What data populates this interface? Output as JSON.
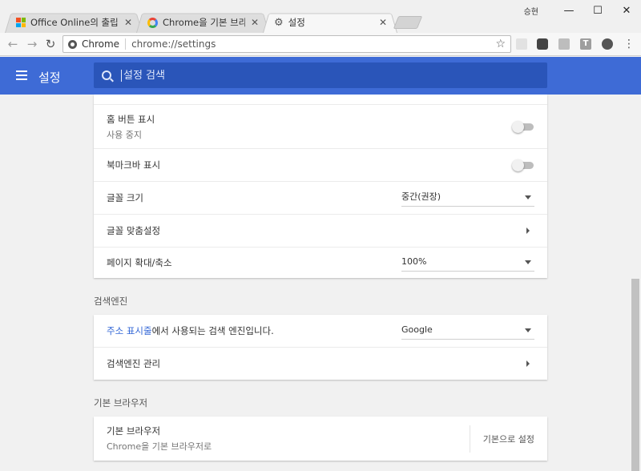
{
  "window": {
    "user_label": "승현",
    "minimize": "—",
    "maximize": "☐",
    "close": "✕"
  },
  "tabs": [
    {
      "label": "Office Online의 출립 아",
      "icon": "microsoft-icon"
    },
    {
      "label": "Chrome을 기본 브라우저",
      "icon": "google-icon"
    },
    {
      "label": "설정",
      "icon": "gear-icon"
    }
  ],
  "tab_close": "✕",
  "toolbar": {
    "back": "←",
    "forward": "→",
    "reload": "↻",
    "omnibox_chip": "Chrome",
    "url": "chrome://settings",
    "star": "☆",
    "ext_t": "T",
    "menu": "⋮"
  },
  "header": {
    "title": "설정",
    "search_placeholder": "설정 검색"
  },
  "appearance": {
    "home_button_title": "홈 버튼 표시",
    "home_button_sub": "사용 중지",
    "bookmarks_bar_title": "북마크바 표시",
    "font_size_title": "글꼴 크기",
    "font_size_value": "중간(권장)",
    "customize_fonts_title": "글꼴 맞춤설정",
    "page_zoom_title": "페이지 확대/축소",
    "page_zoom_value": "100%"
  },
  "search_engine": {
    "section_title": "검색엔진",
    "address_bar_link": "주소 표시줄",
    "address_bar_rest": "에서 사용되는 검색 엔진입니다.",
    "engine_value": "Google",
    "manage_title": "검색엔진 관리"
  },
  "default_browser": {
    "section_title": "기본 브라우저",
    "row_title": "기본 브라우저",
    "row_sub": "Chrome을 기본 브라우저로",
    "button_label": "기본으로 설정"
  },
  "colors": {
    "header_blue": "#3e6bd6",
    "search_blue": "#2a55b9",
    "link_blue": "#3367d6"
  }
}
